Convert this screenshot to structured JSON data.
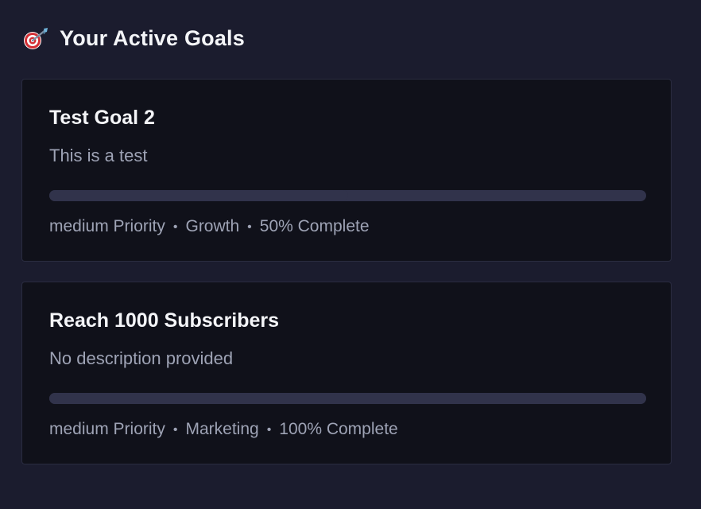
{
  "header": {
    "icon": "dart-target-icon",
    "title": "Your Active Goals"
  },
  "goals": [
    {
      "title": "Test Goal 2",
      "description": "This is a test",
      "priority": "medium Priority",
      "category": "Growth",
      "completion": "50% Complete",
      "progress_fraction": 0.5
    },
    {
      "title": "Reach 1000 Subscribers",
      "description": "No description provided",
      "priority": "medium Priority",
      "category": "Marketing",
      "completion": "100% Complete",
      "progress_fraction": 1.0
    }
  ],
  "separator": "•",
  "colors": {
    "background": "#1b1c2e",
    "card_background": "#10111a",
    "card_border": "#2a2c40",
    "title_text": "#f4f5f8",
    "muted_text": "#9ea3b5",
    "progress_track": "#31334b"
  }
}
